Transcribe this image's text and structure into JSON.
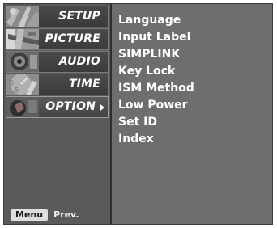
{
  "sidebar": {
    "items": [
      {
        "label": "SETUP",
        "icon": "setup-thumbnail-icon"
      },
      {
        "label": "PICTURE",
        "icon": "picture-thumbnail-icon"
      },
      {
        "label": "AUDIO",
        "icon": "audio-thumbnail-icon"
      },
      {
        "label": "TIME",
        "icon": "time-thumbnail-icon"
      },
      {
        "label": "OPTION",
        "icon": "option-thumbnail-icon",
        "selected": true
      }
    ]
  },
  "options": [
    "Language",
    "Input Label",
    "SIMPLINK",
    "Key Lock",
    "ISM Method",
    "Low Power",
    "Set ID",
    "Index"
  ],
  "footer": {
    "key_label": "Menu",
    "action_label": "Prev."
  },
  "colors": {
    "panel_bg": "#6e6e6e",
    "sidebar_bg": "#5a5a5a",
    "text": "#ffffff"
  }
}
